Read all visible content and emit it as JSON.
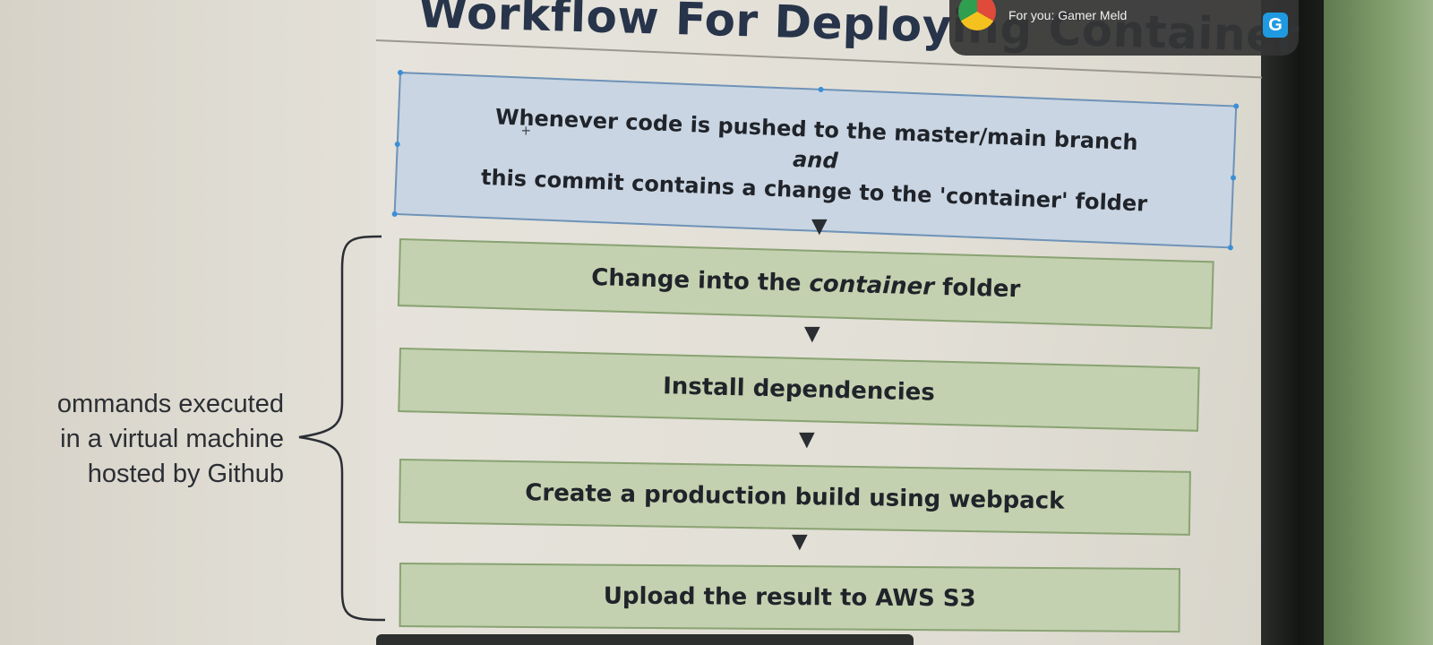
{
  "notification": {
    "text": "For you: Gamer Meld",
    "app_icon_letter": "G"
  },
  "diagram": {
    "title": "Workflow For Deploying Container",
    "trigger": {
      "line1": "Whenever code is pushed to the master/main branch",
      "connector": "and",
      "line2": "this commit contains a change to the 'container' folder"
    },
    "steps": {
      "step1": {
        "before": "Change into the ",
        "emphasis": "container",
        "after": " folder"
      },
      "step2": {
        "text": "Install dependencies"
      },
      "step3": {
        "text": "Create a production build using webpack"
      },
      "step4": {
        "text": "Upload the result to AWS S3"
      }
    },
    "side_label": {
      "line1": "ommands executed",
      "line2": "in a virtual machine",
      "line3": "hosted by Github"
    }
  },
  "colors": {
    "title": "#27344a",
    "trigger_fill": "#c9d5e2",
    "trigger_border": "#6f93b8",
    "step_fill": "#c3d1b0",
    "step_border": "#8aa373"
  },
  "icons": {
    "arrow": "arrow-down-icon",
    "brace": "curly-brace-icon"
  }
}
